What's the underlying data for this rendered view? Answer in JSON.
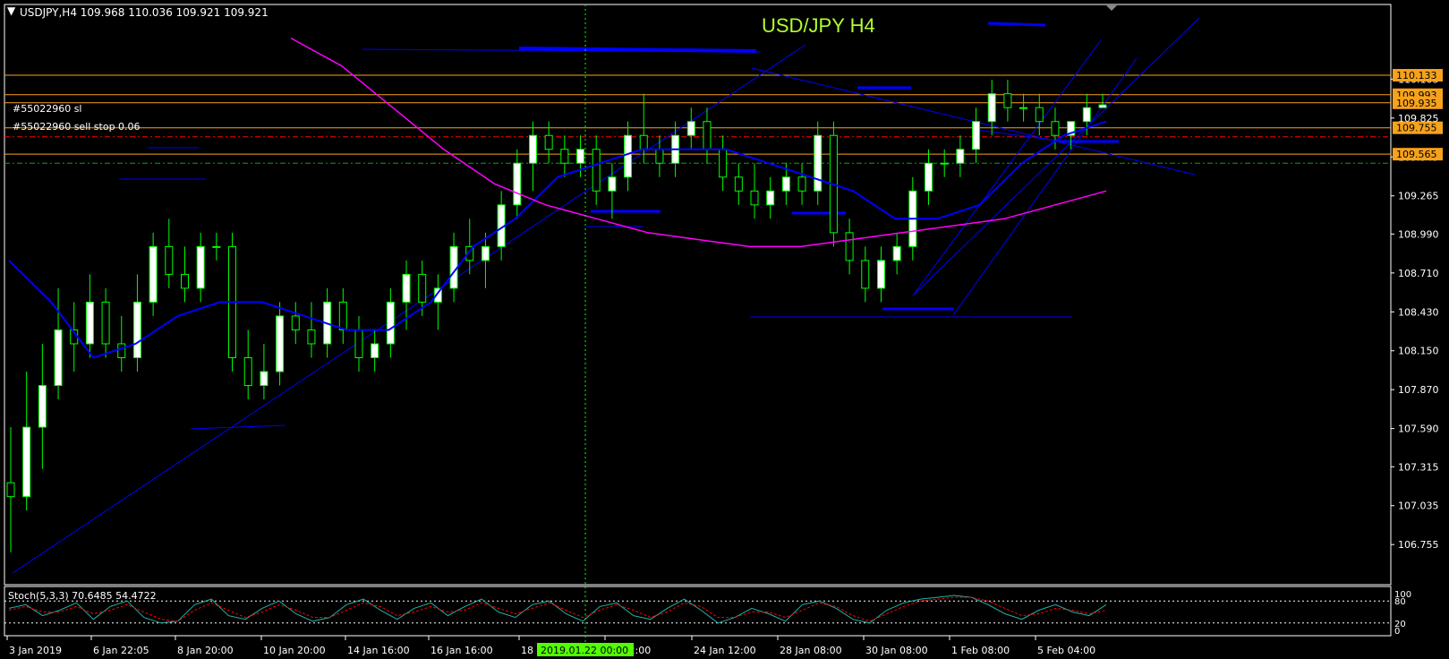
{
  "chart_data": {
    "type": "candlestick",
    "symbol_header": "USDJPY,H4  109.968 110.036 109.921 109.921",
    "title": "USD/JPY  H4",
    "price_axis": {
      "ylim": [
        106.55,
        110.52
      ],
      "ticks": [
        "110.105",
        "109.825",
        "109.545",
        "109.265",
        "108.990",
        "108.710",
        "108.430",
        "108.150",
        "107.870",
        "107.590",
        "107.315",
        "107.035",
        "106.755"
      ]
    },
    "time_axis": {
      "ticks": [
        "3 Jan 2019",
        "6 Jan 22:05",
        "8 Jan 20:00",
        "10 Jan 20:00",
        "14 Jan 16:00",
        "16 Jan 16:00",
        "18",
        "22 12:00",
        "24 Jan 12:00",
        "28 Jan 08:00",
        "30 Jan 08:00",
        "1 Feb 08:00",
        "5 Feb 04:00"
      ],
      "cursor_label": "2019.01.22 00:00"
    },
    "price_labels": [
      {
        "value": 110.133,
        "text": "110.133",
        "color": "#f7a21b"
      },
      {
        "value": 109.993,
        "text": "109.993",
        "color": "#f7a21b"
      },
      {
        "value": 109.935,
        "text": "109.935",
        "color": "#f7a21b"
      },
      {
        "value": 109.755,
        "text": "109.755",
        "color": "#f7a21b"
      },
      {
        "value": 109.565,
        "text": "109.565",
        "color": "#f7a21b"
      }
    ],
    "order_labels": [
      "#55022960 sl",
      "#55022960 sell stop 0.06"
    ],
    "candles": [
      [
        107.2,
        107.6,
        106.7,
        107.1
      ],
      [
        107.1,
        108.0,
        107.0,
        107.6
      ],
      [
        107.6,
        108.2,
        107.3,
        107.9
      ],
      [
        107.9,
        108.6,
        107.8,
        108.3
      ],
      [
        108.3,
        108.5,
        108.0,
        108.2
      ],
      [
        108.2,
        108.7,
        108.1,
        108.5
      ],
      [
        108.5,
        108.6,
        108.1,
        108.2
      ],
      [
        108.2,
        108.4,
        108.0,
        108.1
      ],
      [
        108.1,
        108.7,
        108.0,
        108.5
      ],
      [
        108.5,
        109.0,
        108.4,
        108.9
      ],
      [
        108.9,
        109.1,
        108.6,
        108.7
      ],
      [
        108.7,
        108.9,
        108.5,
        108.6
      ],
      [
        108.6,
        109.0,
        108.5,
        108.9
      ],
      [
        108.9,
        109.0,
        108.8,
        108.9
      ],
      [
        108.9,
        109.0,
        108.0,
        108.1
      ],
      [
        108.1,
        108.3,
        107.8,
        107.9
      ],
      [
        107.9,
        108.2,
        107.8,
        108.0
      ],
      [
        108.0,
        108.5,
        107.9,
        108.4
      ],
      [
        108.4,
        108.5,
        108.2,
        108.3
      ],
      [
        108.3,
        108.5,
        108.1,
        108.2
      ],
      [
        108.2,
        108.6,
        108.1,
        108.5
      ],
      [
        108.5,
        108.6,
        108.2,
        108.3
      ],
      [
        108.3,
        108.4,
        108.0,
        108.1
      ],
      [
        108.1,
        108.3,
        108.0,
        108.2
      ],
      [
        108.2,
        108.6,
        108.1,
        108.5
      ],
      [
        108.5,
        108.8,
        108.3,
        108.7
      ],
      [
        108.7,
        108.8,
        108.4,
        108.5
      ],
      [
        108.5,
        108.7,
        108.3,
        108.6
      ],
      [
        108.6,
        109.0,
        108.5,
        108.9
      ],
      [
        108.9,
        109.1,
        108.7,
        108.8
      ],
      [
        108.8,
        109.0,
        108.6,
        108.9
      ],
      [
        108.9,
        109.3,
        108.8,
        109.2
      ],
      [
        109.2,
        109.6,
        109.1,
        109.5
      ],
      [
        109.5,
        109.8,
        109.3,
        109.7
      ],
      [
        109.7,
        109.8,
        109.5,
        109.6
      ],
      [
        109.6,
        109.7,
        109.4,
        109.5
      ],
      [
        109.5,
        109.7,
        109.4,
        109.6
      ],
      [
        109.6,
        109.7,
        109.2,
        109.3
      ],
      [
        109.3,
        109.5,
        109.1,
        109.4
      ],
      [
        109.4,
        109.8,
        109.3,
        109.7
      ],
      [
        109.7,
        110.0,
        109.5,
        109.6
      ],
      [
        109.6,
        109.7,
        109.4,
        109.5
      ],
      [
        109.5,
        109.8,
        109.4,
        109.7
      ],
      [
        109.7,
        109.9,
        109.6,
        109.8
      ],
      [
        109.8,
        109.9,
        109.5,
        109.6
      ],
      [
        109.6,
        109.7,
        109.3,
        109.4
      ],
      [
        109.4,
        109.5,
        109.2,
        109.3
      ],
      [
        109.3,
        109.5,
        109.1,
        109.2
      ],
      [
        109.2,
        109.4,
        109.1,
        109.3
      ],
      [
        109.3,
        109.5,
        109.2,
        109.4
      ],
      [
        109.4,
        109.5,
        109.2,
        109.3
      ],
      [
        109.3,
        109.8,
        109.2,
        109.7
      ],
      [
        109.7,
        109.8,
        108.9,
        109.0
      ],
      [
        109.0,
        109.1,
        108.7,
        108.8
      ],
      [
        108.8,
        108.9,
        108.5,
        108.6
      ],
      [
        108.6,
        108.9,
        108.5,
        108.8
      ],
      [
        108.8,
        109.0,
        108.7,
        108.9
      ],
      [
        108.9,
        109.4,
        108.8,
        109.3
      ],
      [
        109.3,
        109.6,
        109.2,
        109.5
      ],
      [
        109.5,
        109.6,
        109.4,
        109.5
      ],
      [
        109.5,
        109.7,
        109.4,
        109.6
      ],
      [
        109.6,
        109.9,
        109.5,
        109.8
      ],
      [
        109.8,
        110.1,
        109.7,
        110.0
      ],
      [
        110.0,
        110.1,
        109.8,
        109.9
      ],
      [
        109.9,
        110.0,
        109.8,
        109.9
      ],
      [
        109.9,
        110.0,
        109.7,
        109.8
      ],
      [
        109.8,
        109.9,
        109.6,
        109.7
      ],
      [
        109.7,
        109.8,
        109.6,
        109.8
      ],
      [
        109.8,
        110.0,
        109.7,
        109.9
      ],
      [
        109.9,
        110.0,
        109.9,
        109.92
      ]
    ],
    "ma_blue": [
      108.8,
      108.5,
      108.1,
      108.2,
      108.4,
      108.5,
      108.5,
      108.4,
      108.3,
      108.3,
      108.5,
      108.9,
      109.1,
      109.4,
      109.5,
      109.6,
      109.6,
      109.6,
      109.5,
      109.4,
      109.3,
      109.1,
      109.1,
      109.2,
      109.5,
      109.7,
      109.8
    ],
    "ma_magenta": [
      110.4,
      110.2,
      109.9,
      109.6,
      109.35,
      109.2,
      109.1,
      109.0,
      108.95,
      108.9,
      108.9,
      108.95,
      109.0,
      109.05,
      109.1,
      109.2,
      109.3
    ],
    "indicator": {
      "label": "Stoch(5,3,3) 70.6485 54.4722",
      "levels": [
        "100",
        "80",
        "20",
        "0"
      ],
      "main": [
        60,
        70,
        40,
        55,
        75,
        30,
        65,
        80,
        35,
        20,
        25,
        70,
        85,
        40,
        30,
        60,
        80,
        45,
        25,
        35,
        70,
        85,
        55,
        30,
        60,
        75,
        40,
        65,
        85,
        50,
        35,
        70,
        80,
        45,
        25,
        65,
        75,
        40,
        30,
        60,
        85,
        55,
        20,
        35,
        60,
        45,
        25,
        70,
        80,
        60,
        30,
        20,
        55,
        75,
        85,
        90,
        95,
        90,
        70,
        45,
        30,
        55,
        70,
        50,
        40,
        70
      ],
      "signal": [
        55,
        65,
        50,
        50,
        65,
        45,
        55,
        70,
        50,
        30,
        25,
        55,
        75,
        55,
        35,
        50,
        70,
        55,
        35,
        35,
        55,
        75,
        65,
        40,
        50,
        65,
        50,
        55,
        75,
        60,
        45,
        60,
        75,
        55,
        35,
        55,
        70,
        55,
        35,
        50,
        75,
        65,
        35,
        35,
        50,
        50,
        35,
        55,
        75,
        65,
        40,
        25,
        45,
        65,
        80,
        85,
        90,
        90,
        80,
        60,
        40,
        45,
        60,
        55,
        45,
        55
      ]
    },
    "colors": {
      "bull": "#ffffff",
      "bear": "#00ff00",
      "ma_blue": "#0000ff",
      "ma_magenta": "#ff00ff",
      "level": "#f7a21b",
      "title": "#b0ff30",
      "cursor": "#00ff00",
      "stoch_main": "#20b2aa",
      "stoch_signal": "#ff0000",
      "grid_dash": "#ffffff"
    }
  }
}
